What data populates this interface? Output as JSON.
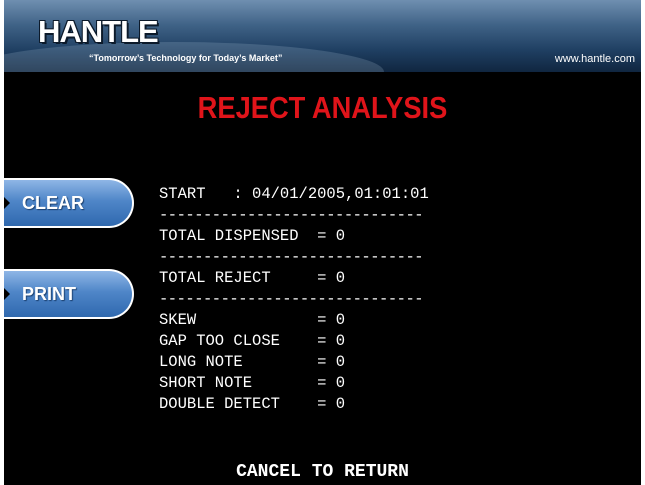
{
  "header": {
    "logo_text": "HANTLE",
    "tagline": "“Tomorrow’s Technology for Today’s Market”",
    "website": "www.hantle.com"
  },
  "screen": {
    "title": "REJECT ANALYSIS",
    "title_color": "#e0141a",
    "footer": "CANCEL TO RETURN"
  },
  "buttons": {
    "clear": "CLEAR",
    "print": "PRINT"
  },
  "report": {
    "start": "START   : 04/01/2005,01:01:01",
    "separator": "------------------------------",
    "total_dispensed": "TOTAL DISPENSED  = 0",
    "total_reject": "TOTAL REJECT     = 0",
    "details": [
      "SKEW             = 0",
      "GAP TOO CLOSE    = 0",
      "LONG NOTE        = 0",
      "SHORT NOTE       = 0",
      "DOUBLE DETECT    = 0"
    ]
  }
}
